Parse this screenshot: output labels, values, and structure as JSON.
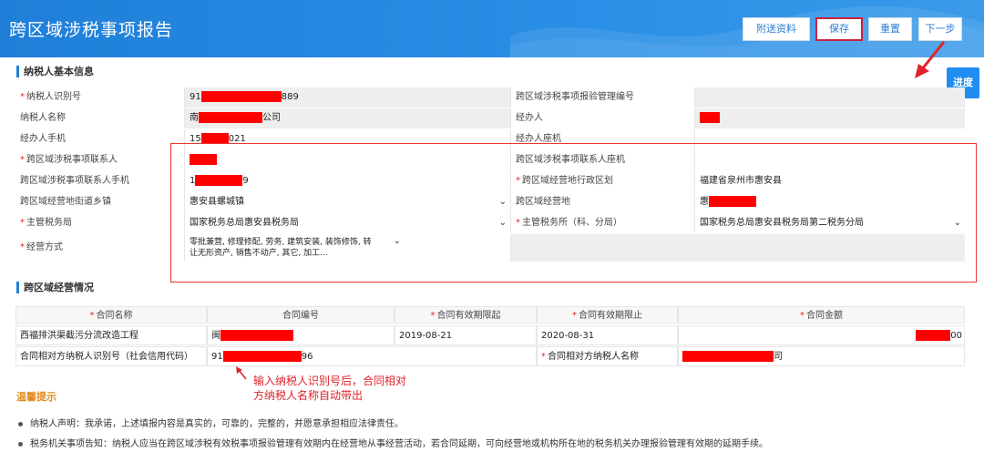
{
  "header": {
    "title": "跨区域涉税事项报告",
    "buttons": {
      "attach": "附送资料",
      "save": "保存",
      "reset": "重置",
      "next": "下一步"
    },
    "progress": "进度"
  },
  "section1": {
    "title": "纳税人基本信息"
  },
  "basic": {
    "taxpayer_id_label": "纳税人识别号",
    "taxpayer_id_prefix": "91",
    "taxpayer_id_suffix": "889",
    "report_no_label": "跨区域涉税事项报验管理编号",
    "report_no_value": "",
    "taxpayer_name_label": "纳税人名称",
    "taxpayer_name_prefix": "南",
    "taxpayer_name_suffix": "公司",
    "agent_label": "经办人",
    "agent_value": "",
    "agent_phone_label": "经办人手机",
    "agent_phone_prefix": "15",
    "agent_phone_suffix": "021",
    "agent_tel_label": "经办人座机",
    "agent_tel_value": "",
    "contact_label": "跨区域涉税事项联系人",
    "contact_value": "",
    "contact_tel_label": "跨区域涉税事项联系人座机",
    "contact_tel_value": "",
    "contact_phone_label": "跨区域涉税事项联系人手机",
    "contact_phone_prefix": "1",
    "contact_phone_suffix": "9",
    "region_label": "跨区域经营地行政区划",
    "region_value": "福建省泉州市惠安县",
    "street_label": "跨区域经营地街道乡镇",
    "street_value": "惠安县螺城镇",
    "address_label": "跨区域经营地",
    "address_prefix": "惠",
    "bureau_label": "主管税务局",
    "bureau_value": "国家税务总局惠安县税务局",
    "office_label": "主管税务所（科、分局）",
    "office_value": "国家税务总局惠安县税务局第二税务分局",
    "mode_label": "经营方式",
    "mode_line1": "零批兼营, 修理修配, 劳务, 建筑安装, 装饰修饰, 转",
    "mode_line2": "让无形资产, 销售不动产, 其它, 加工..."
  },
  "section2": {
    "title": "跨区域经营情况"
  },
  "contract": {
    "headers": [
      "合同名称",
      "合同编号",
      "合同有效期限起",
      "合同有效期限止",
      "合同金额"
    ],
    "name": "西福排洪渠截污分流改造工程",
    "number_prefix": "闽",
    "start": "2019-08-21",
    "end": "2020-08-31",
    "amount_suffix": "00",
    "party_id_label": "合同相对方纳税人识别号（社会信用代码）",
    "party_id_prefix": "91",
    "party_id_suffix": "96",
    "party_name_label": "合同相对方纳税人名称",
    "party_name_suffix": "司"
  },
  "annotation": {
    "line1": "输入纳税人识别号后，合同相对",
    "line2": "方纳税人名称自动带出"
  },
  "tips": {
    "title": "温馨提示",
    "items": [
      "纳税人声明：我承诺，上述填报内容是真实的，可靠的，完整的，并愿意承担相应法律责任。",
      "税务机关事项告知：纳税人应当在跨区域涉税有效税事项报验管理有效期内在经营地从事经营活动，若合同延期，可向经营地或机构所在地的税务机关办理报验管理有效期的延期手续。"
    ]
  },
  "colors": {
    "header_blue": "#1f7fd8",
    "required": "#e0232b",
    "annotation": "#e0232b"
  }
}
